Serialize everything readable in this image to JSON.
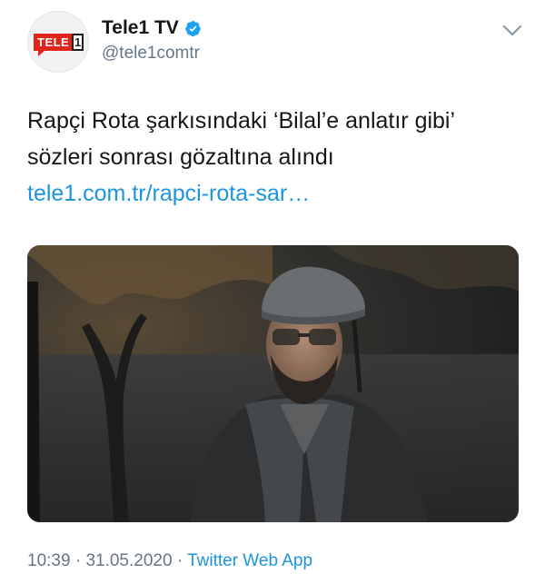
{
  "account": {
    "display_name": "Tele1 TV",
    "handle": "@tele1comtr",
    "verified": true,
    "avatar_logo_text": "TELE",
    "avatar_logo_digit": "1"
  },
  "tweet": {
    "text_lines": [
      "Rapçi Rota şarkısındaki ‘Bilal’e anlatır gibi’",
      "sözleri sonrası gözaltına alındı"
    ],
    "link": "tele1.com.tr/rapci-rota-sar…"
  },
  "meta": {
    "time": "10:39",
    "separator": "·",
    "date": "31.05.2020",
    "source": "Twitter Web App"
  },
  "colors": {
    "text": "#14171a",
    "secondary": "#657786",
    "link": "#1b95e0",
    "verified_badge": "#1da1f2",
    "logo_red": "#e1251b"
  },
  "icons": {
    "verified": "verified-badge-icon",
    "menu": "chevron-down-icon"
  }
}
